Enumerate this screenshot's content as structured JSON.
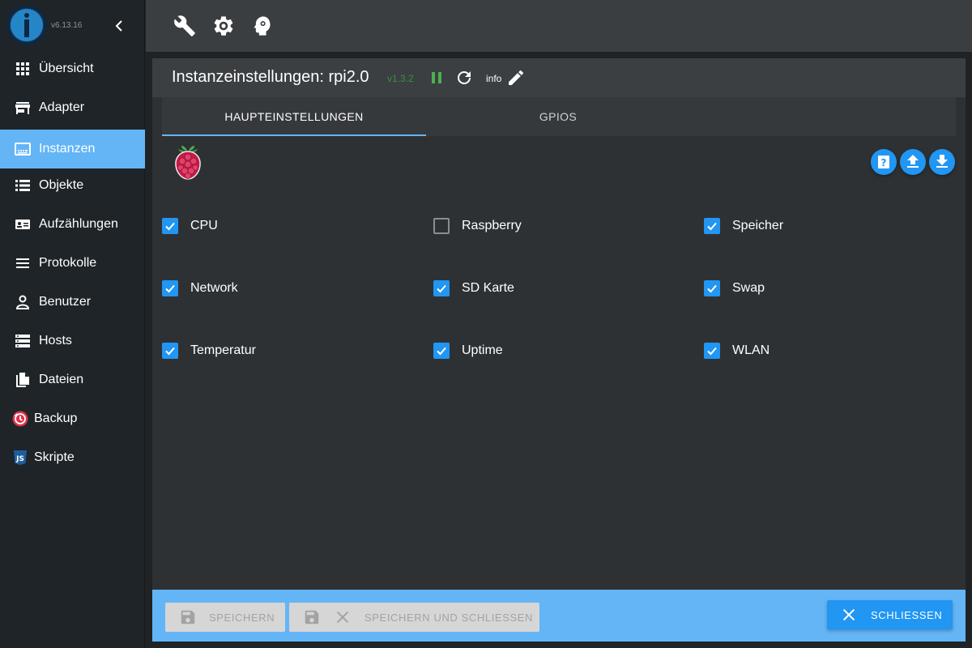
{
  "app": {
    "version": "v6.13.16"
  },
  "sidebar": {
    "items": [
      {
        "label": "Übersicht",
        "icon": "grid-icon"
      },
      {
        "label": "Adapter",
        "icon": "store-icon"
      },
      {
        "label": "Instanzen",
        "icon": "instances-icon",
        "active": true
      },
      {
        "label": "Objekte",
        "icon": "list-icon"
      },
      {
        "label": "Aufzählungen",
        "icon": "enum-card-icon"
      },
      {
        "label": "Protokolle",
        "icon": "menu-lines-icon"
      },
      {
        "label": "Benutzer",
        "icon": "person-icon"
      },
      {
        "label": "Hosts",
        "icon": "server-icon"
      },
      {
        "label": "Dateien",
        "icon": "files-icon"
      },
      {
        "label": "Backup",
        "icon": "backup-clock-icon"
      },
      {
        "label": "Skripte",
        "icon": "js-icon"
      }
    ]
  },
  "topbar": {
    "icons": [
      "wrench-icon",
      "gear-icon",
      "expert-head-icon"
    ]
  },
  "panel": {
    "title": "Instanzeinstellungen: rpi2.0",
    "version": "v1.3.2",
    "info_label": "info",
    "tabs": [
      {
        "label": "HAUPTEINSTELLUNGEN",
        "active": true
      },
      {
        "label": "GPIOS",
        "active": false
      }
    ],
    "options": [
      {
        "label": "CPU",
        "checked": true
      },
      {
        "label": "Raspberry",
        "checked": false
      },
      {
        "label": "Speicher",
        "checked": true
      },
      {
        "label": "Network",
        "checked": true
      },
      {
        "label": "SD Karte",
        "checked": true
      },
      {
        "label": "Swap",
        "checked": true
      },
      {
        "label": "Temperatur",
        "checked": true
      },
      {
        "label": "Uptime",
        "checked": true
      },
      {
        "label": "WLAN",
        "checked": true
      }
    ]
  },
  "footer": {
    "save_label": "SPEICHERN",
    "save_close_label": "SPEICHERN UND SCHLIESSEN",
    "close_label": "SCHLIESSEN"
  },
  "colors": {
    "accent": "#64b5f6",
    "primary": "#2196f3",
    "running": "#4caf50",
    "version_text": "#3c8f3c"
  }
}
